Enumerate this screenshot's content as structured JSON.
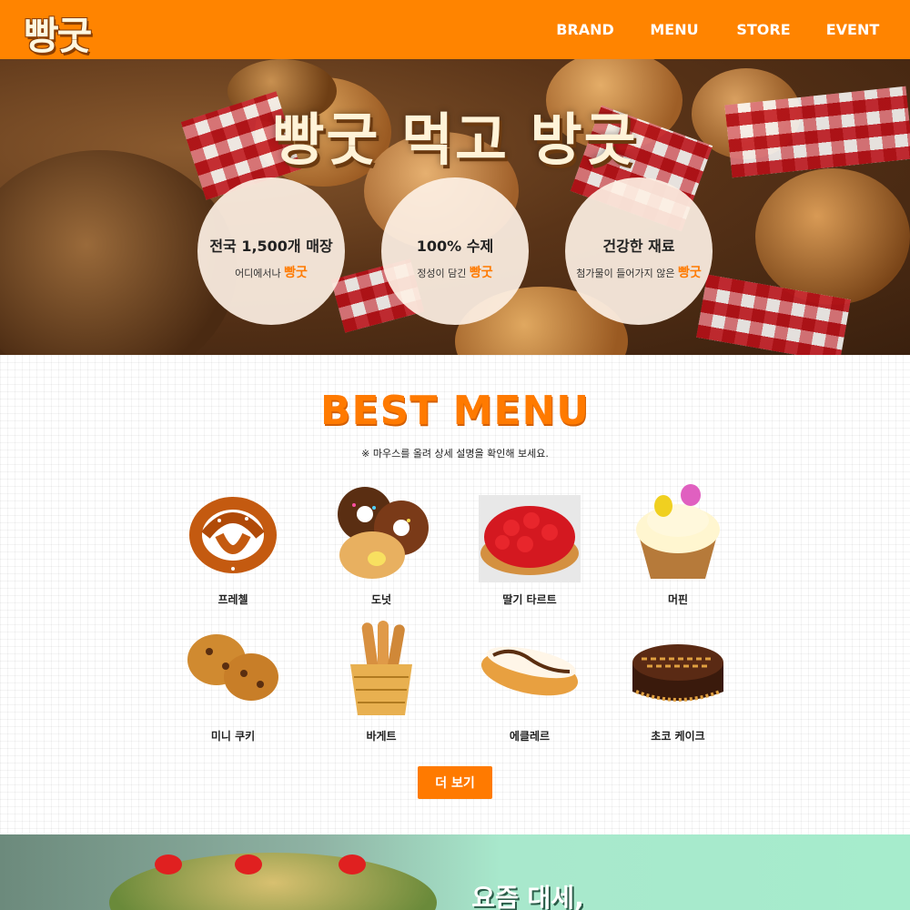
{
  "header": {
    "logo": "빵굿",
    "nav": [
      "BRAND",
      "MENU",
      "STORE",
      "EVENT"
    ]
  },
  "hero": {
    "title": "빵굿 먹고 방긋",
    "features": [
      {
        "title": "전국 1,500개 매장",
        "sub": "어디에서나",
        "brand": "빵굿"
      },
      {
        "title": "100% 수제",
        "sub": "정성이 담긴",
        "brand": "빵굿"
      },
      {
        "title": "건강한 재료",
        "sub": "첨가물이 들어가지 않은",
        "brand": "빵굿"
      }
    ]
  },
  "best_menu": {
    "title": "BEST MENU",
    "subtitle": "※ 마우스를 올려 상세 설명을 확인해 보세요.",
    "items": [
      {
        "name": "프레첼",
        "icon": "pretzel-image"
      },
      {
        "name": "도넛",
        "icon": "donut-image"
      },
      {
        "name": "딸기 타르트",
        "icon": "strawberry-tart-image"
      },
      {
        "name": "머핀",
        "icon": "muffin-image"
      },
      {
        "name": "미니 쿠키",
        "icon": "cookie-image"
      },
      {
        "name": "바게트",
        "icon": "baguette-image"
      },
      {
        "name": "에클레르",
        "icon": "eclair-image"
      },
      {
        "name": "초코 케이크",
        "icon": "chocolate-cake-image"
      }
    ],
    "more_label": "더 보기"
  },
  "banner": {
    "text": "요즘 대세,"
  },
  "colors": {
    "accent": "#ff8400",
    "brand_text": "#ff7a00"
  }
}
